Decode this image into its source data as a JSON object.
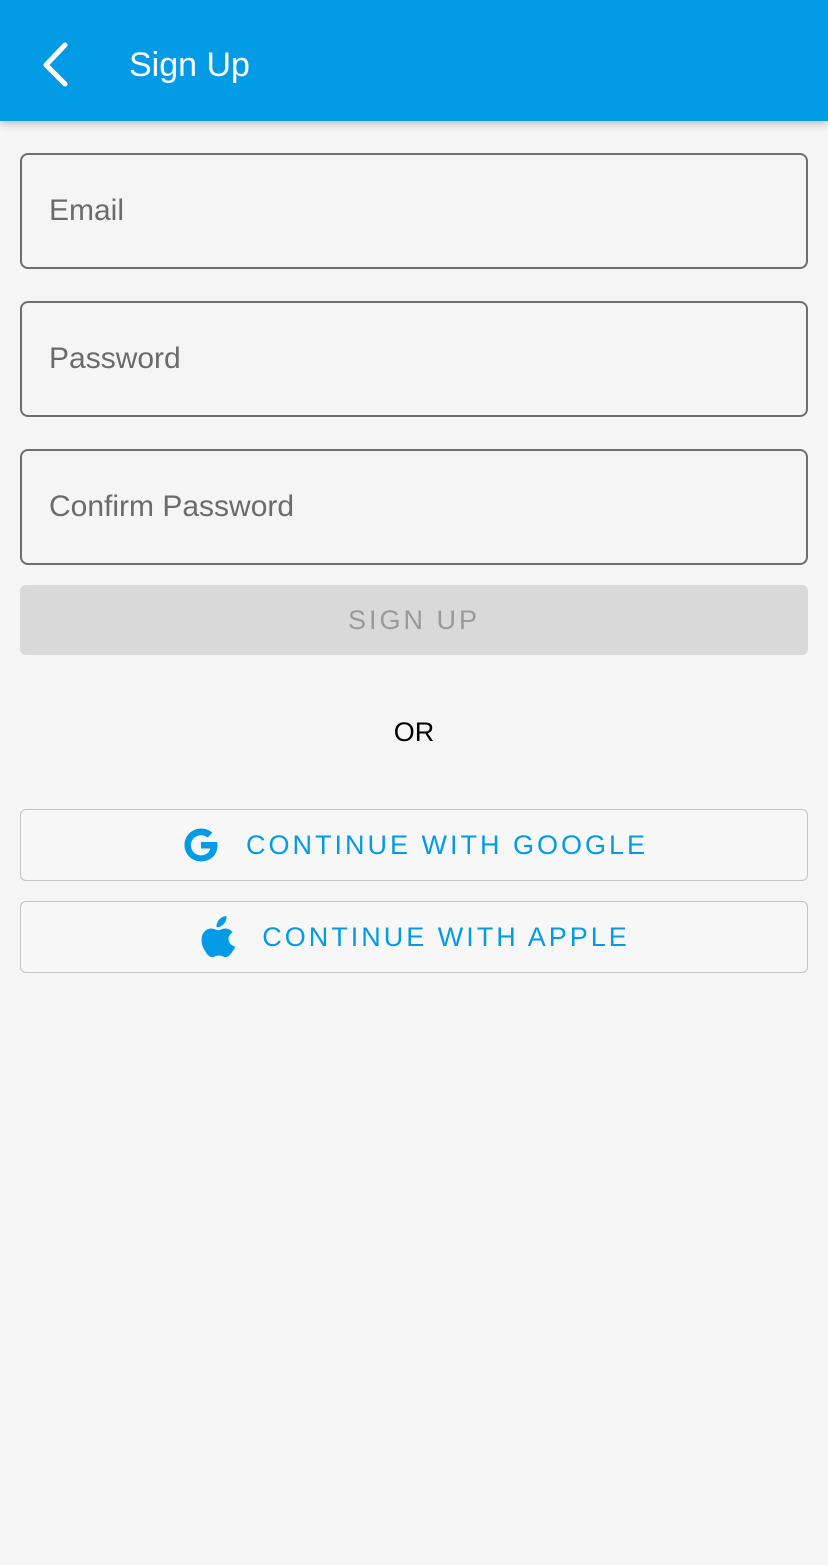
{
  "header": {
    "title": "Sign Up",
    "back_icon": "chevron-left-icon",
    "background_color": "#039be5"
  },
  "form": {
    "email": {
      "placeholder": "Email",
      "value": ""
    },
    "password": {
      "placeholder": "Password",
      "value": ""
    },
    "confirm_password": {
      "placeholder": "Confirm Password",
      "value": ""
    },
    "submit_label": "SIGN UP"
  },
  "divider_text": "OR",
  "social": {
    "google": {
      "label": "CONTINUE WITH GOOGLE",
      "icon": "google-icon"
    },
    "apple": {
      "label": "CONTINUE WITH APPLE",
      "icon": "apple-icon"
    }
  },
  "colors": {
    "accent": "#039be5",
    "disabled_button": "#d9d9d9",
    "disabled_text": "#9a9a9a",
    "background": "#f5f5f5"
  }
}
